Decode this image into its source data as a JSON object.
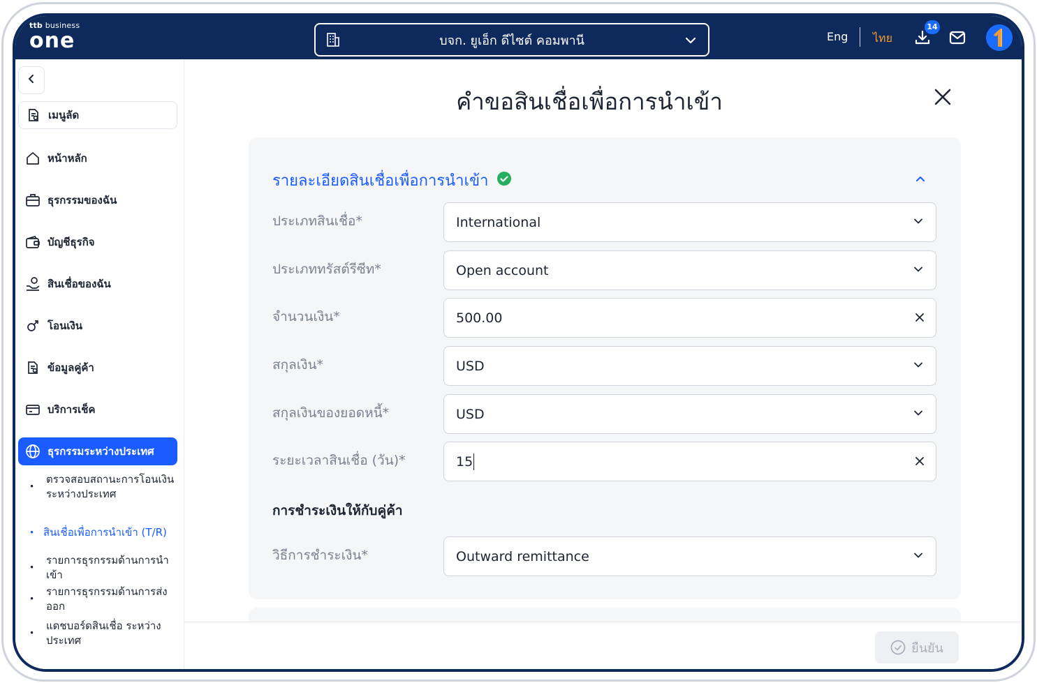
{
  "header": {
    "logo_small_brand": "ttb",
    "logo_small_text": "business",
    "logo_big": "one",
    "company_name": "บจก. ยูเอ็ก ดีไซต์ คอมพานี",
    "lang_eng": "Eng",
    "lang_th": "ไทย",
    "download_badge": "14",
    "colors": {
      "bar": "#0e2a5c",
      "active_lang": "#f39c2c",
      "badge": "#1a6bff"
    }
  },
  "sidebar": {
    "shortcut_label": "เมนูลัด",
    "items": [
      {
        "label": "หน้าหลัก",
        "icon": "home-icon"
      },
      {
        "label": "ธุรกรรมของฉัน",
        "icon": "briefcase-icon"
      },
      {
        "label": "บัญชีธุรกิจ",
        "icon": "wallet-icon"
      },
      {
        "label": "สินเชื่อของฉัน",
        "icon": "loan-hand-icon"
      },
      {
        "label": "โอนเงิน",
        "icon": "transfer-icon"
      },
      {
        "label": "ข้อมูลคู่ค้า",
        "icon": "partner-doc-icon"
      },
      {
        "label": "บริการเช็ค",
        "icon": "cheque-icon"
      },
      {
        "label": "ธุรกรรมระหว่างประเทศ",
        "icon": "globe-icon",
        "active": true
      }
    ],
    "sub_items": [
      {
        "label": "ตรวจสอบสถานะการโอนเงินระหว่างประเทศ"
      },
      {
        "label": "สินเชื่อเพื่อการนำเข้า (T/R)",
        "active": true
      },
      {
        "label": "รายการธุรกรรมด้านการนำเข้า"
      },
      {
        "label": "รายการธุรกรรมด้านการส่งออก"
      },
      {
        "label": "แดชบอร์ดสินเชื่อ ระหว่างประเทศ"
      }
    ],
    "accent_color": "#1a5cff"
  },
  "main": {
    "page_title": "คำขอสินเชื่อเพื่อการนำเข้า",
    "section_title": "รายละเอียดสินเชื่อเพื่อการนำเข้า",
    "fields": [
      {
        "label": "ประเภทสินเชื่อ*",
        "value": "International",
        "control": "dropdown"
      },
      {
        "label": "ประเภททรัสต์รีซีท*",
        "value": "Open account",
        "control": "dropdown"
      },
      {
        "label": "จำนวนเงิน*",
        "value": "500.00",
        "control": "clearable"
      },
      {
        "label": "สกุลเงิน*",
        "value": "USD",
        "control": "dropdown"
      },
      {
        "label": "สกุลเงินของยอดหนี้*",
        "value": "USD",
        "control": "dropdown"
      },
      {
        "label": "ระยะเวลาสินเชื่อ (วัน)*",
        "value": "15",
        "control": "clearable"
      }
    ],
    "payment_heading": "การชำระเงินให้กับคู่ค้า",
    "payment_field": {
      "label": "วิธีการชำระเงิน*",
      "value": "Outward remittance",
      "control": "dropdown"
    }
  },
  "footer": {
    "confirm_label": "ยืนยัน"
  }
}
